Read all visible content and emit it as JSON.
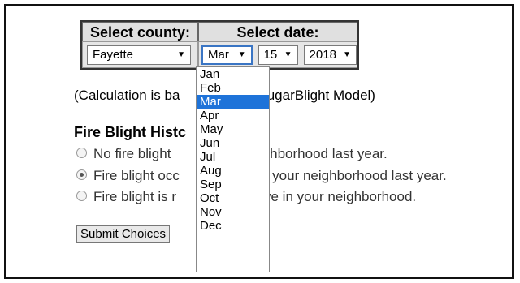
{
  "form": {
    "county_header": "Select county:",
    "date_header": "Select date:",
    "county_value": "Fayette",
    "month_value": "Mar",
    "day_value": "15",
    "year_value": "2018",
    "dropdown_arrow": "▼"
  },
  "calc_note": {
    "left": "(Calculation is ba",
    "right": "CougarBlight Model)"
  },
  "history_heading": "Fire Blight Histc",
  "radios": [
    {
      "left": "No fire blight",
      "right": "neighborhood last year.",
      "checked": false
    },
    {
      "left": "Fire blight occ",
      "right": "n your neighborhood last year.",
      "checked": true
    },
    {
      "left": "Fire blight is r",
      "right": "ve in your neighborhood.",
      "checked": false
    }
  ],
  "submit_label": "Submit Choices",
  "month_options": [
    "Jan",
    "Feb",
    "Mar",
    "Apr",
    "May",
    "Jun",
    "Jul",
    "Aug",
    "Sep",
    "Oct",
    "Nov",
    "Dec"
  ],
  "selected_month_index": 2,
  "colors": {
    "selection": "#1e73d9",
    "focus_border": "#3a75c4"
  }
}
